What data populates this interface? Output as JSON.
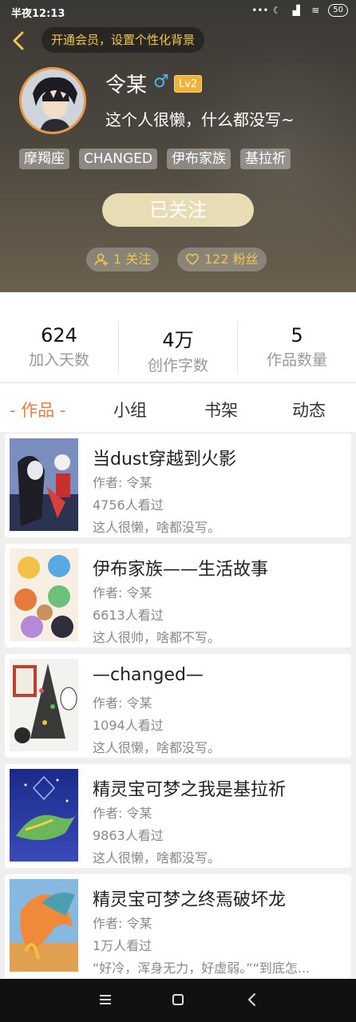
{
  "status_bar": {
    "time": "半夜12:13",
    "battery": "50"
  },
  "header": {
    "vip_prompt": "开通会员，设置个性化背景",
    "name": "令某",
    "gender_symbol": "♂",
    "level": "Lv2",
    "bio": "这个人很懒，什么都没写~",
    "tags": [
      "摩羯座",
      "CHANGED",
      "伊布家族",
      "基拉祈"
    ],
    "follow_button": "已关注",
    "following": "1 关注",
    "fans": "122 粉丝"
  },
  "stats": [
    {
      "value": "624",
      "label": "加入天数"
    },
    {
      "value": "4万",
      "label": "创作字数"
    },
    {
      "value": "5",
      "label": "作品数量"
    }
  ],
  "tabs": [
    {
      "label": "- 作品 -",
      "active": true
    },
    {
      "label": "小组",
      "active": false
    },
    {
      "label": "书架",
      "active": false
    },
    {
      "label": "动态",
      "active": false
    }
  ],
  "works": [
    {
      "title": "当dust穿越到火影",
      "author": "作者: 令某",
      "views": "4756人看过",
      "desc": "这人很懒，啥都没写。"
    },
    {
      "title": "伊布家族——生活故事",
      "author": "作者: 令某",
      "views": "6613人看过",
      "desc": "这人很帅，啥都不写。"
    },
    {
      "title": "—changed—",
      "author": "作者: 令某",
      "views": "1094人看过",
      "desc": "这人很懒，啥都没写。"
    },
    {
      "title": "精灵宝可梦之我是基拉祈",
      "author": "作者: 令某",
      "views": "9863人看过",
      "desc": "这人很懒，啥都没写。"
    },
    {
      "title": "精灵宝可梦之终焉破坏龙",
      "author": "作者: 令某",
      "views": "1万人看过",
      "desc": "“好冷，浑身无力，好虚弱。”“到底怎..."
    }
  ],
  "colors": {
    "accent": "#f07b3c",
    "gold": "#f3c64a",
    "follow_bg": "#e8dcb4"
  }
}
